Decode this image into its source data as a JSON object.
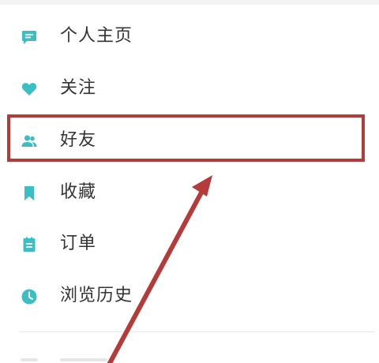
{
  "menu": {
    "items": [
      {
        "label": "个人主页",
        "icon": "comment-icon"
      },
      {
        "label": "关注",
        "icon": "heart-icon"
      },
      {
        "label": "好友",
        "icon": "people-icon"
      },
      {
        "label": "收藏",
        "icon": "bookmark-icon"
      },
      {
        "label": "订单",
        "icon": "clipboard-icon"
      },
      {
        "label": "浏览历史",
        "icon": "clock-icon"
      }
    ]
  },
  "colors": {
    "icon": "#3cbfc4",
    "label": "#333333",
    "annotation": "#b53b3b"
  }
}
